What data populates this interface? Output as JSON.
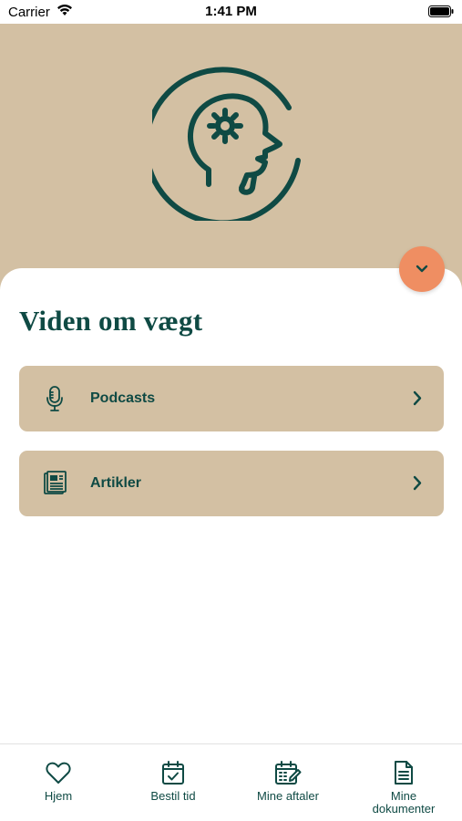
{
  "status_bar": {
    "carrier": "Carrier",
    "time": "1:41 PM"
  },
  "page": {
    "title": "Viden om vægt"
  },
  "menu": [
    {
      "label": "Podcasts",
      "icon": "microphone-icon"
    },
    {
      "label": "Artikler",
      "icon": "newspaper-icon"
    }
  ],
  "tabs": [
    {
      "label": "Hjem",
      "icon": "heart-icon"
    },
    {
      "label": "Bestil tid",
      "icon": "calendar-check-icon"
    },
    {
      "label": "Mine aftaler",
      "icon": "calendar-edit-icon"
    },
    {
      "label": "Mine dokumenter",
      "icon": "document-icon"
    }
  ],
  "colors": {
    "primary": "#0f4a44",
    "hero_background": "#d3c0a3",
    "accent": "#ef8e62"
  }
}
